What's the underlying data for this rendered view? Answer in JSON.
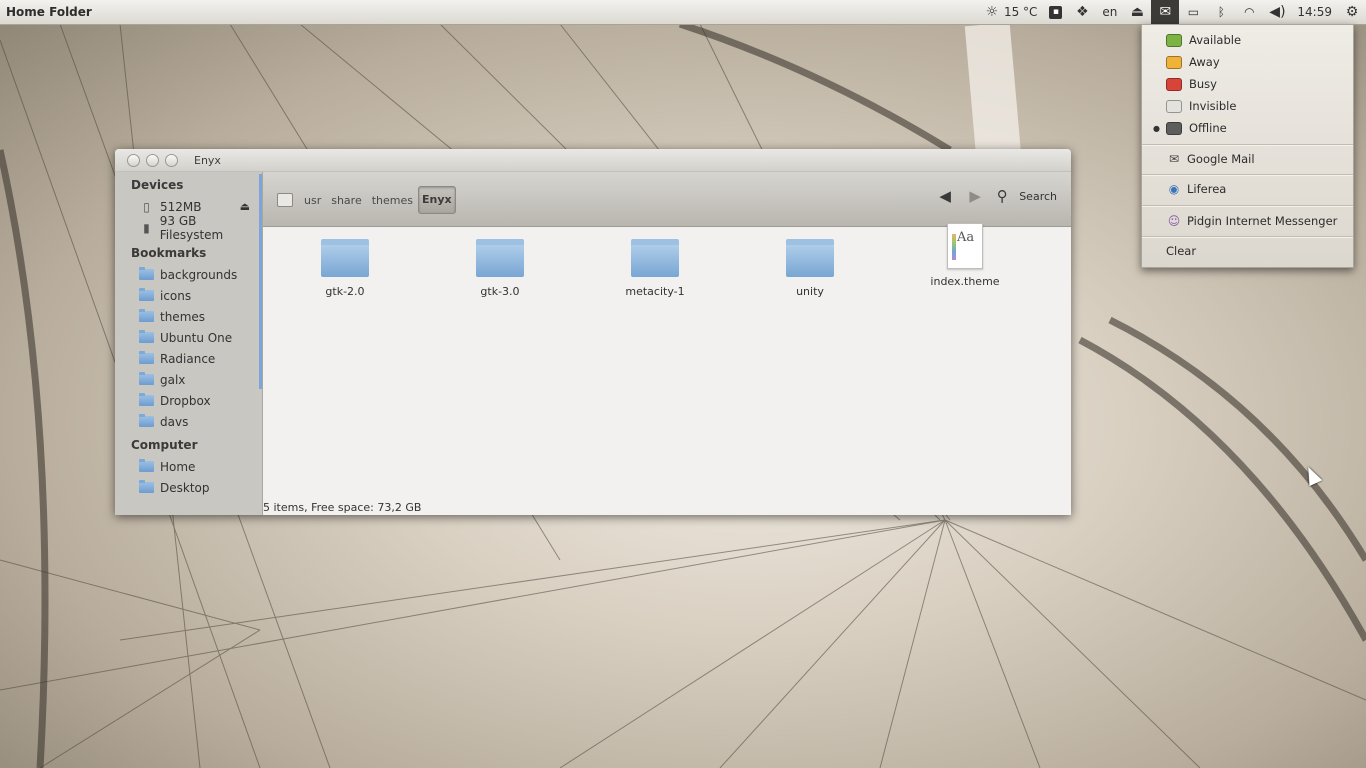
{
  "panel": {
    "title": "Home Folder",
    "weather": "15 °C",
    "language": "en",
    "clock": "14:59"
  },
  "window": {
    "title": "Enyx",
    "sidebar": {
      "devices_header": "Devices",
      "devices": [
        {
          "label": "512MB",
          "icon": "usb-drive-icon"
        },
        {
          "label": "93 GB Filesystem",
          "icon": "hard-disk-icon"
        }
      ],
      "bookmarks_header": "Bookmarks",
      "bookmarks": [
        "backgrounds",
        "icons",
        "themes",
        "Ubuntu One",
        "Radiance",
        "galx",
        "Dropbox",
        "davs"
      ],
      "computer_header": "Computer",
      "computer": [
        "Home",
        "Desktop"
      ]
    },
    "breadcrumbs": [
      "usr",
      "share",
      "themes",
      "Enyx"
    ],
    "search_label": "Search",
    "files": [
      {
        "name": "gtk-2.0",
        "type": "folder"
      },
      {
        "name": "gtk-3.0",
        "type": "folder"
      },
      {
        "name": "metacity-1",
        "type": "folder"
      },
      {
        "name": "unity",
        "type": "folder"
      },
      {
        "name": "index.theme",
        "type": "file"
      }
    ],
    "status": "5 items, Free space: 73,2 GB"
  },
  "messaging_menu": {
    "statuses": [
      {
        "label": "Available",
        "color": "#7cb342"
      },
      {
        "label": "Away",
        "color": "#f0b33a"
      },
      {
        "label": "Busy",
        "color": "#d9443a"
      },
      {
        "label": "Invisible",
        "color": "#e4e2dd"
      },
      {
        "label": "Offline",
        "color": "#5d5d5d",
        "selected": true
      }
    ],
    "apps": [
      {
        "label": "Google Mail",
        "icon": "envelope-icon"
      },
      {
        "label": "Liferea",
        "icon": "liferea-icon"
      },
      {
        "label": "Pidgin Internet Messenger",
        "icon": "pidgin-icon"
      }
    ],
    "clear_label": "Clear"
  }
}
